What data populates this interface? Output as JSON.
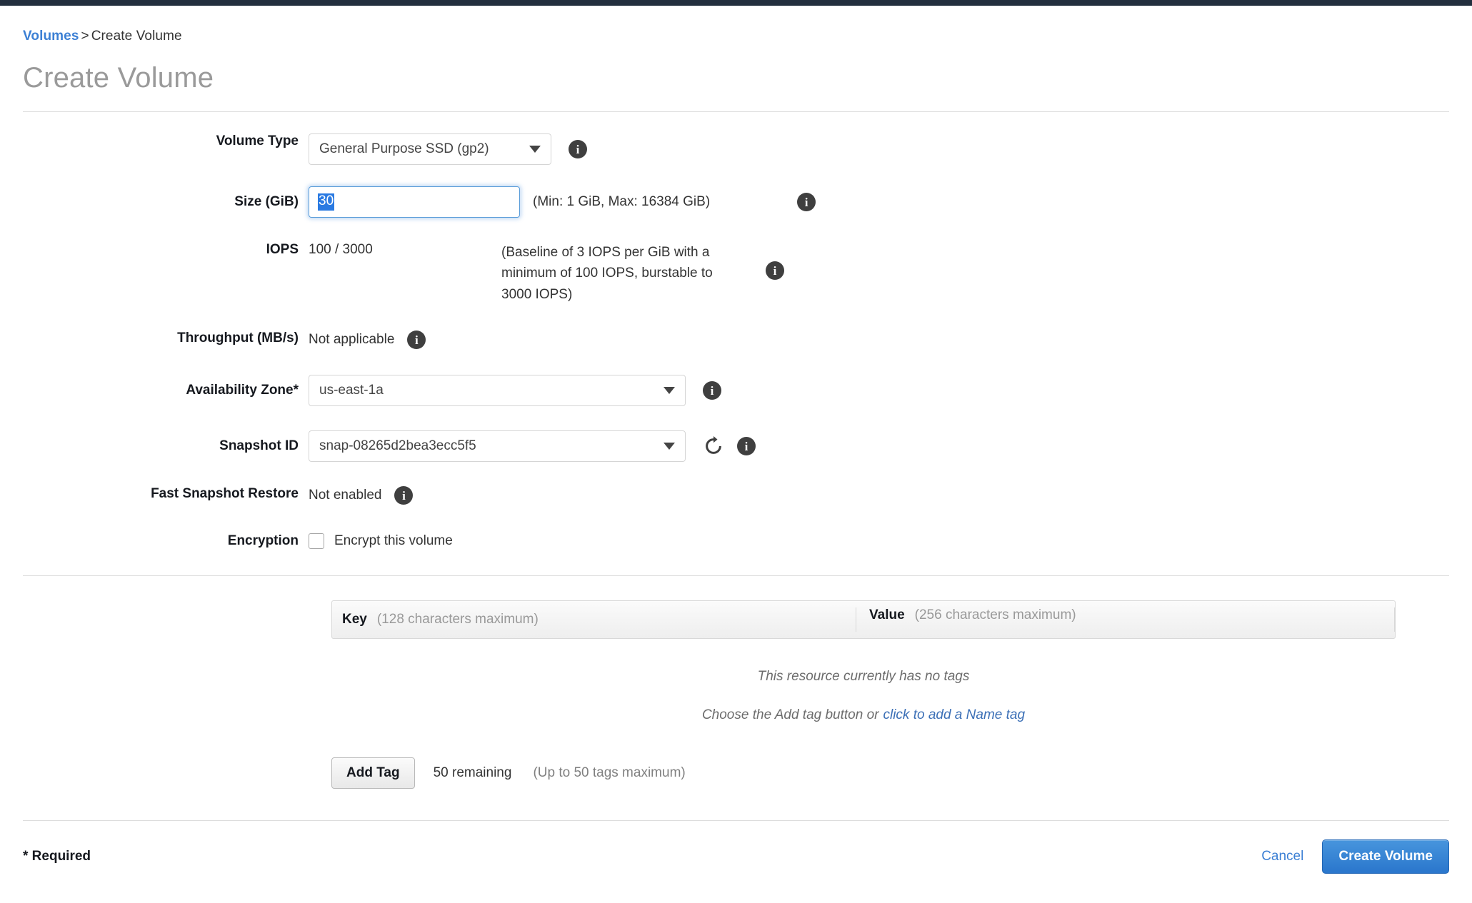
{
  "breadcrumb": {
    "link_label": "Volumes",
    "separator": ">",
    "current_label": "Create Volume"
  },
  "page_title": "Create Volume",
  "form": {
    "volume_type": {
      "label": "Volume Type",
      "value": "General Purpose SSD (gp2)",
      "info_icon": "info-icon"
    },
    "size": {
      "label": "Size (GiB)",
      "value": "30",
      "hint": "(Min: 1 GiB, Max: 16384 GiB)",
      "info_icon": "info-icon"
    },
    "iops": {
      "label": "IOPS",
      "value": "100 / 3000",
      "note": "(Baseline of 3 IOPS per GiB with a minimum of 100 IOPS, burstable to 3000 IOPS)",
      "info_icon": "info-icon"
    },
    "throughput": {
      "label": "Throughput (MB/s)",
      "value": "Not applicable",
      "info_icon": "info-icon"
    },
    "availability_zone": {
      "label": "Availability Zone*",
      "value": "us-east-1a",
      "info_icon": "info-icon"
    },
    "snapshot_id": {
      "label": "Snapshot ID",
      "value": "snap-08265d2bea3ecc5f5",
      "refresh_icon": "refresh-icon",
      "info_icon": "info-icon"
    },
    "fast_snapshot_restore": {
      "label": "Fast Snapshot Restore",
      "value": "Not enabled",
      "info_icon": "info-icon"
    },
    "encryption": {
      "label": "Encryption",
      "checkbox_label": "Encrypt this volume",
      "checked": false
    }
  },
  "tags": {
    "header": {
      "key_label": "Key",
      "key_hint": "(128 characters maximum)",
      "value_label": "Value",
      "value_hint": "(256 characters maximum)"
    },
    "empty_message": "This resource currently has no tags",
    "empty_hint_prefix": "Choose the Add tag button or",
    "empty_hint_link": "click to add a Name tag",
    "add_tag_button": "Add Tag",
    "remaining": "50 remaining",
    "max_note": "(Up to 50 tags maximum)"
  },
  "footer": {
    "required_note": "* Required",
    "cancel_label": "Cancel",
    "submit_label": "Create Volume"
  },
  "colors": {
    "top_bar": "#232f3e",
    "link": "#3b7fd4",
    "primary_button": "#2a76cc",
    "selection_highlight": "#2a7ae2",
    "focus_border": "#5b9dd9",
    "title_gray": "#9a9a9a"
  }
}
